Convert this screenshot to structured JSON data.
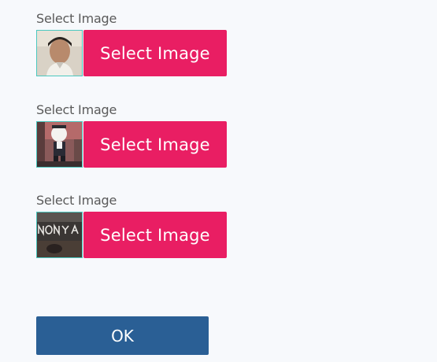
{
  "fields": [
    {
      "label": "Select Image",
      "button_label": "Select Image",
      "thumbnail_icon": "portrait-photo"
    },
    {
      "label": "Select Image",
      "button_label": "Select Image",
      "thumbnail_icon": "cartoon-figure-photo"
    },
    {
      "label": "Select Image",
      "button_label": "Select Image",
      "thumbnail_icon": "nonya-text-photo"
    }
  ],
  "ok_label": "OK",
  "colors": {
    "select_button": "#e91e63",
    "ok_button": "#2a5f95",
    "thumbnail_border": "#4cc9c0",
    "background": "#f7f9fc"
  }
}
